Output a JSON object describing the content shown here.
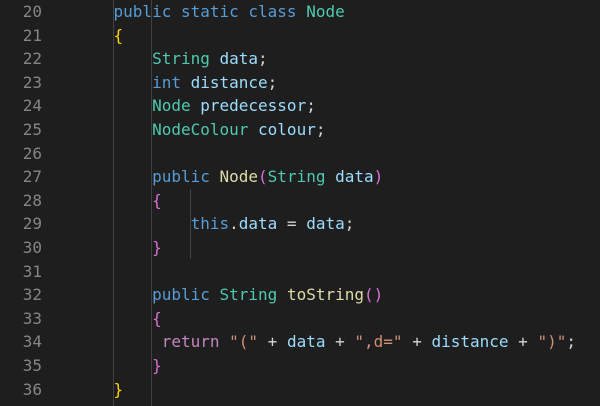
{
  "editor": {
    "line_numbers": [
      "20",
      "21",
      "22",
      "23",
      "24",
      "25",
      "26",
      "27",
      "28",
      "29",
      "30",
      "31",
      "32",
      "33",
      "34",
      "35",
      "36"
    ],
    "lines": [
      [
        {
          "t": "    "
        },
        {
          "t": "public static class ",
          "c": "kw"
        },
        {
          "t": "Node",
          "c": "type"
        }
      ],
      [
        {
          "t": "    "
        },
        {
          "t": "{",
          "c": "br-y"
        }
      ],
      [
        {
          "t": "        "
        },
        {
          "t": "String",
          "c": "type"
        },
        {
          "t": " "
        },
        {
          "t": "data",
          "c": "id"
        },
        {
          "t": ";",
          "c": "plain"
        }
      ],
      [
        {
          "t": "        "
        },
        {
          "t": "int",
          "c": "kw"
        },
        {
          "t": " "
        },
        {
          "t": "distance",
          "c": "id"
        },
        {
          "t": ";",
          "c": "plain"
        }
      ],
      [
        {
          "t": "        "
        },
        {
          "t": "Node",
          "c": "type"
        },
        {
          "t": " "
        },
        {
          "t": "predecessor",
          "c": "id"
        },
        {
          "t": ";",
          "c": "plain"
        }
      ],
      [
        {
          "t": "        "
        },
        {
          "t": "NodeColour",
          "c": "type"
        },
        {
          "t": " "
        },
        {
          "t": "colour",
          "c": "id"
        },
        {
          "t": ";",
          "c": "plain"
        }
      ],
      [],
      [
        {
          "t": "        "
        },
        {
          "t": "public",
          "c": "kw"
        },
        {
          "t": " "
        },
        {
          "t": "Node",
          "c": "fn"
        },
        {
          "t": "(",
          "c": "br-p"
        },
        {
          "t": "String",
          "c": "type"
        },
        {
          "t": " "
        },
        {
          "t": "data",
          "c": "id"
        },
        {
          "t": ")",
          "c": "br-p"
        }
      ],
      [
        {
          "t": "        "
        },
        {
          "t": "{",
          "c": "br-p"
        }
      ],
      [
        {
          "t": "            "
        },
        {
          "t": "this",
          "c": "kw"
        },
        {
          "t": ".",
          "c": "plain"
        },
        {
          "t": "data",
          "c": "id"
        },
        {
          "t": " = ",
          "c": "plain"
        },
        {
          "t": "data",
          "c": "id"
        },
        {
          "t": ";",
          "c": "plain"
        }
      ],
      [
        {
          "t": "        "
        },
        {
          "t": "}",
          "c": "br-p"
        }
      ],
      [],
      [
        {
          "t": "        "
        },
        {
          "t": "public",
          "c": "kw"
        },
        {
          "t": " "
        },
        {
          "t": "String",
          "c": "type"
        },
        {
          "t": " "
        },
        {
          "t": "toString",
          "c": "fn"
        },
        {
          "t": "()",
          "c": "br-p"
        }
      ],
      [
        {
          "t": "        "
        },
        {
          "t": "{",
          "c": "br-p"
        }
      ],
      [
        {
          "t": "         "
        },
        {
          "t": "return",
          "c": "ctl"
        },
        {
          "t": " "
        },
        {
          "t": "\"(\"",
          "c": "str"
        },
        {
          "t": " + ",
          "c": "plain"
        },
        {
          "t": "data",
          "c": "id"
        },
        {
          "t": " + ",
          "c": "plain"
        },
        {
          "t": "\",d=\"",
          "c": "str"
        },
        {
          "t": " + ",
          "c": "plain"
        },
        {
          "t": "distance",
          "c": "id"
        },
        {
          "t": " + ",
          "c": "plain"
        },
        {
          "t": "\")\"",
          "c": "str"
        },
        {
          "t": ";",
          "c": "plain"
        }
      ],
      [
        {
          "t": "        "
        },
        {
          "t": "}",
          "c": "br-p"
        }
      ],
      [
        {
          "t": "    "
        },
        {
          "t": "}",
          "c": "br-y"
        }
      ]
    ]
  }
}
